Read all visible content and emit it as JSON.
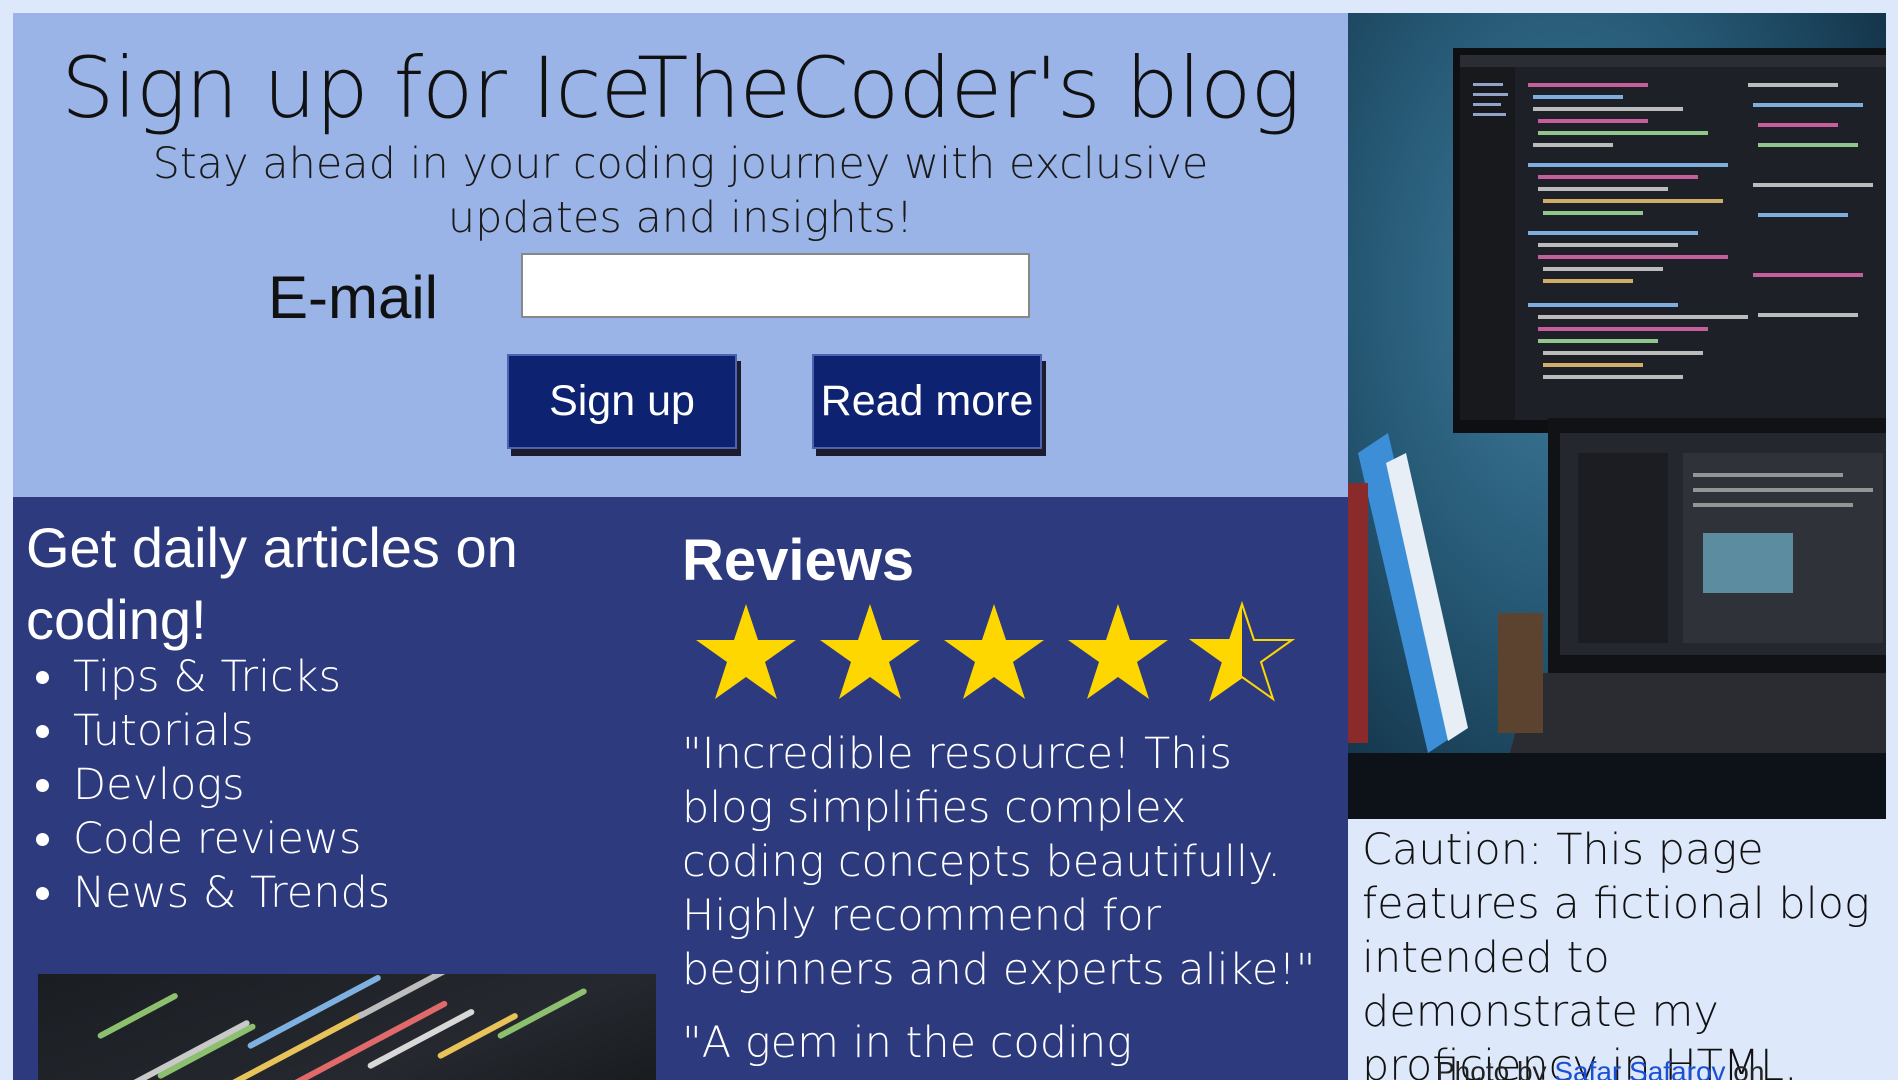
{
  "signup": {
    "title": "Sign up for IceTheCoder's blog",
    "subtitle": "Stay ahead in your coding journey with exclusive updates and insights!",
    "email_label": "E-mail",
    "email_value": "",
    "email_placeholder": "",
    "signup_label": "Sign up",
    "read_more_label": "Read more"
  },
  "articles": {
    "title": "Get daily articles on coding!",
    "items": [
      {
        "label": "Tips & Tricks"
      },
      {
        "label": "Tutorials"
      },
      {
        "label": "Devlogs"
      },
      {
        "label": "Code reviews"
      },
      {
        "label": "News & Trends"
      }
    ]
  },
  "reviews": {
    "title": "Reviews",
    "rating": 4.5,
    "max_rating": 5,
    "star_color": "#ffd700",
    "quotes": [
      "\"Incredible resource! This blog simplifies complex coding concepts beautifully. Highly recommend for beginners and experts alike!\"",
      "\"A gem in the coding"
    ]
  },
  "sidebar": {
    "caution": "Caution: This page features a fictional blog intended to demonstrate my proficiency in HTML.",
    "credit_prefix": "Photo by",
    "credit_author": "Safar Safarov",
    "credit_suffix": "on"
  },
  "colors": {
    "top_panel": "#9ab4e8",
    "lower_panel": "#2d3b7e",
    "button": "#0d2270",
    "page_background": "#dde8fb"
  },
  "icons": {
    "stars": "star-icon",
    "bullets": "bullet-icon"
  }
}
